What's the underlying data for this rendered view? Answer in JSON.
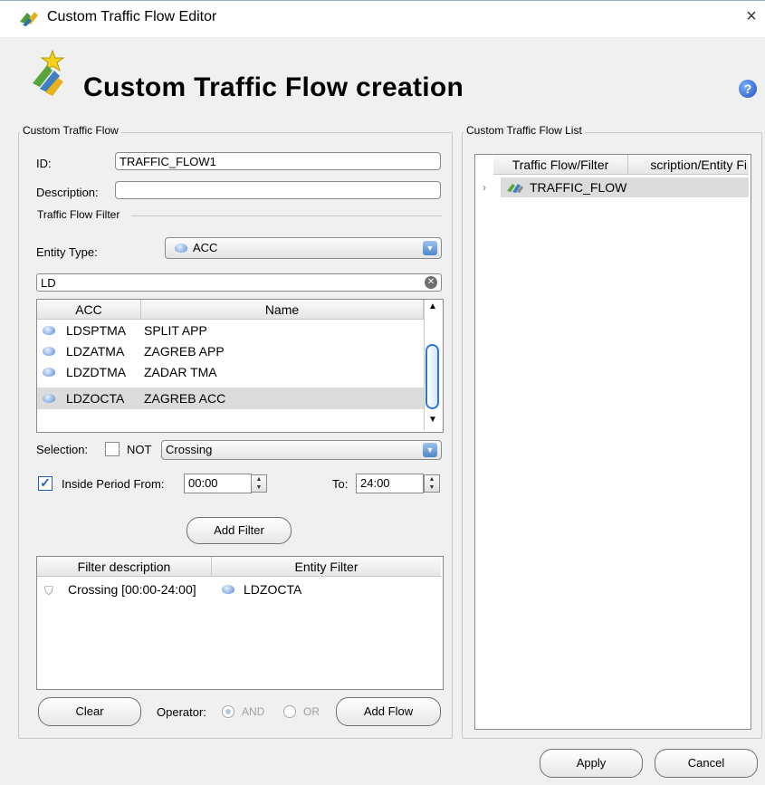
{
  "window": {
    "title": "Custom Traffic Flow Editor",
    "close_glyph": "×"
  },
  "header": {
    "title": "Custom Traffic Flow creation",
    "help_glyph": "?"
  },
  "left_group": {
    "legend": "Custom Traffic Flow",
    "id_label": "ID:",
    "id_value": "TRAFFIC_FLOW1",
    "description_label": "Description:",
    "description_value": "",
    "filter_legend": "Traffic Flow Filter",
    "entity_type_label": "Entity Type:",
    "entity_type_value": "ACC",
    "search_value": "LD",
    "entity_table": {
      "columns": [
        "ACC",
        "Name"
      ],
      "rows": [
        {
          "code": "LDSPTMA",
          "name": "SPLIT APP",
          "selected": false
        },
        {
          "code": "LDZATMA",
          "name": "ZAGREB APP",
          "selected": false
        },
        {
          "code": "LDZDTMA",
          "name": "ZADAR TMA",
          "selected": false
        },
        {
          "code": "LDZOCTA",
          "name": "ZAGREB ACC",
          "selected": true
        }
      ]
    },
    "selection_label": "Selection:",
    "not_label": "NOT",
    "not_checked": false,
    "selection_value": "Crossing",
    "inside_period_label": "Inside Period From:",
    "inside_period_checked": true,
    "from_value": "00:00",
    "to_label": "To:",
    "to_value": "24:00",
    "add_filter_label": "Add Filter",
    "filter_table": {
      "columns": [
        "Filter description",
        "Entity Filter"
      ],
      "rows": [
        {
          "description": "Crossing [00:00-24:00]",
          "entity": "LDZOCTA"
        }
      ]
    },
    "clear_label": "Clear",
    "operator_label": "Operator:",
    "and_label": "AND",
    "or_label": "OR",
    "operator_selected": "AND",
    "add_flow_label": "Add Flow"
  },
  "right_group": {
    "legend": "Custom Traffic Flow List",
    "columns": [
      "Traffic Flow/Filter",
      "scription/Entity Fi"
    ],
    "rows": [
      {
        "name": "TRAFFIC_FLOW",
        "expanded": false
      }
    ]
  },
  "footer": {
    "apply_label": "Apply",
    "cancel_label": "Cancel"
  },
  "colors": {
    "accent": "#2e73d6",
    "selected_row": "#dcdcdc",
    "window_bg": "#f0f0f0"
  },
  "icons": [
    "traffic-flow-app-icon",
    "wizard-star-icon",
    "help-icon",
    "close-icon",
    "acc-gem-icon",
    "filter-funnel-icon",
    "traffic-flow-tree-icon",
    "chevron-right-icon"
  ]
}
